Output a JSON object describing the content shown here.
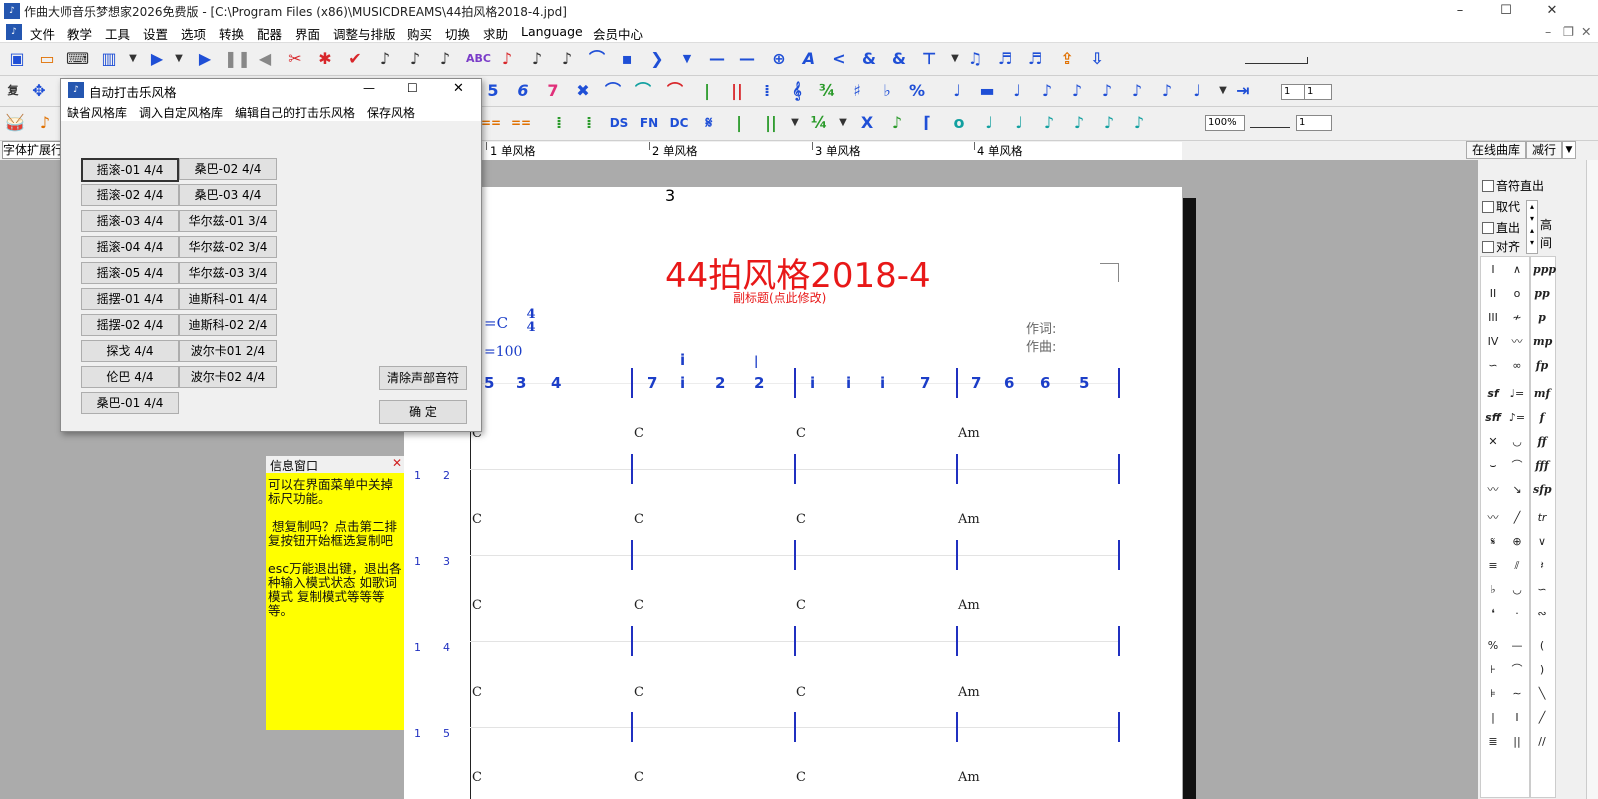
{
  "window": {
    "title": "作曲大师音乐梦想家2026免费版 - [C:\\Program Files (x86)\\MUSICDREAMS\\44拍风格2018-4.jpd]",
    "minimize": "–",
    "maximize": "☐",
    "close": "✕"
  },
  "menu": [
    "文件",
    "教学",
    "工具",
    "设置",
    "选项",
    "转换",
    "配器",
    "界面",
    "调整与排版",
    "购买",
    "切换",
    "求助",
    "Language",
    "会员中心"
  ],
  "toolbar": {
    "font_ext_label": "字体扩展行",
    "zoom": "100%",
    "field_a": "1",
    "field_b": "1",
    "field_c": "1",
    "online_lib": "在线曲库",
    "reduce": "减行",
    "icons_row2": [
      "5",
      "6",
      "7"
    ],
    "icons_row3": [
      "DS",
      "FN",
      "DC"
    ]
  },
  "ruler": {
    "labels": [
      "1 单风格",
      "2 单风格",
      "3 单风格",
      "4 单风格"
    ]
  },
  "score": {
    "page_number": "3",
    "title": "44拍风格2018-4",
    "subtitle": "副标题(点此修改)",
    "key": "=C",
    "time_top": "4",
    "time_bottom": "4",
    "tempo": "=100",
    "lyricist": "作词:",
    "composer": "作曲:",
    "melody": [
      [
        "5",
        "3",
        "4"
      ],
      [
        "7",
        "i",
        "2",
        "2"
      ],
      [
        "i",
        "i",
        "i",
        "7"
      ],
      [
        "7",
        "6",
        "6",
        "5"
      ]
    ],
    "chord_rows": [
      [
        "C",
        "C",
        "C",
        "Am"
      ],
      [
        "C",
        "C",
        "C",
        "Am"
      ],
      [
        "C",
        "C",
        "C",
        "Am"
      ],
      [
        "C",
        "C",
        "C",
        "Am"
      ],
      [
        "C",
        "C",
        "C",
        "Am"
      ]
    ],
    "row_labels": [
      [
        "1",
        "2"
      ],
      [
        "1",
        "3"
      ],
      [
        "1",
        "4"
      ],
      [
        "1",
        "5"
      ]
    ]
  },
  "dialog": {
    "title": "自动打击乐风格",
    "menu": [
      "缺省风格库",
      "调入自定风格库",
      "编辑自己的打击乐风格",
      "保存风格"
    ],
    "styles_left": [
      "摇滚-01 4/4",
      "摇滚-02 4/4",
      "摇滚-03 4/4",
      "摇滚-04 4/4",
      "摇滚-05 4/4",
      "摇摆-01 4/4",
      "摇摆-02 4/4",
      "探戈 4/4",
      "伦巴 4/4",
      "桑巴-01 4/4"
    ],
    "styles_right": [
      "桑巴-02 4/4",
      "桑巴-03 4/4",
      "华尔兹-01 3/4",
      "华尔兹-02 3/4",
      "华尔兹-03 3/4",
      "迪斯科-01 4/4",
      "迪斯科-02 2/4",
      "波尔卡01 2/4",
      "波尔卡02 4/4"
    ],
    "clear_button": "清除声部音符",
    "ok_button": "确  定",
    "minimize": "—",
    "maximize": "☐",
    "close": "✕"
  },
  "info_window": {
    "title": "信息窗口",
    "text": "可以在界面菜单中关掉标尺功能。\n\n 想复制吗？点击第二排 复按钮开始框选复制吧\n\nesc万能退出键，退出各种输入模式状态 如歌词模式 复制模式等等等等。"
  },
  "right_panel": {
    "options": [
      "音符直出",
      "取代",
      "直出",
      "对齐"
    ],
    "side_labels": [
      "高",
      "间"
    ],
    "dynamics": [
      "ppp",
      "pp",
      "p",
      "mp",
      "fp",
      "mf",
      "f",
      "ff",
      "fff",
      "sfp"
    ]
  },
  "colors": {
    "title_red": "#e81818",
    "note_blue": "#1c3ec8",
    "info_yellow": "#ffff00"
  }
}
